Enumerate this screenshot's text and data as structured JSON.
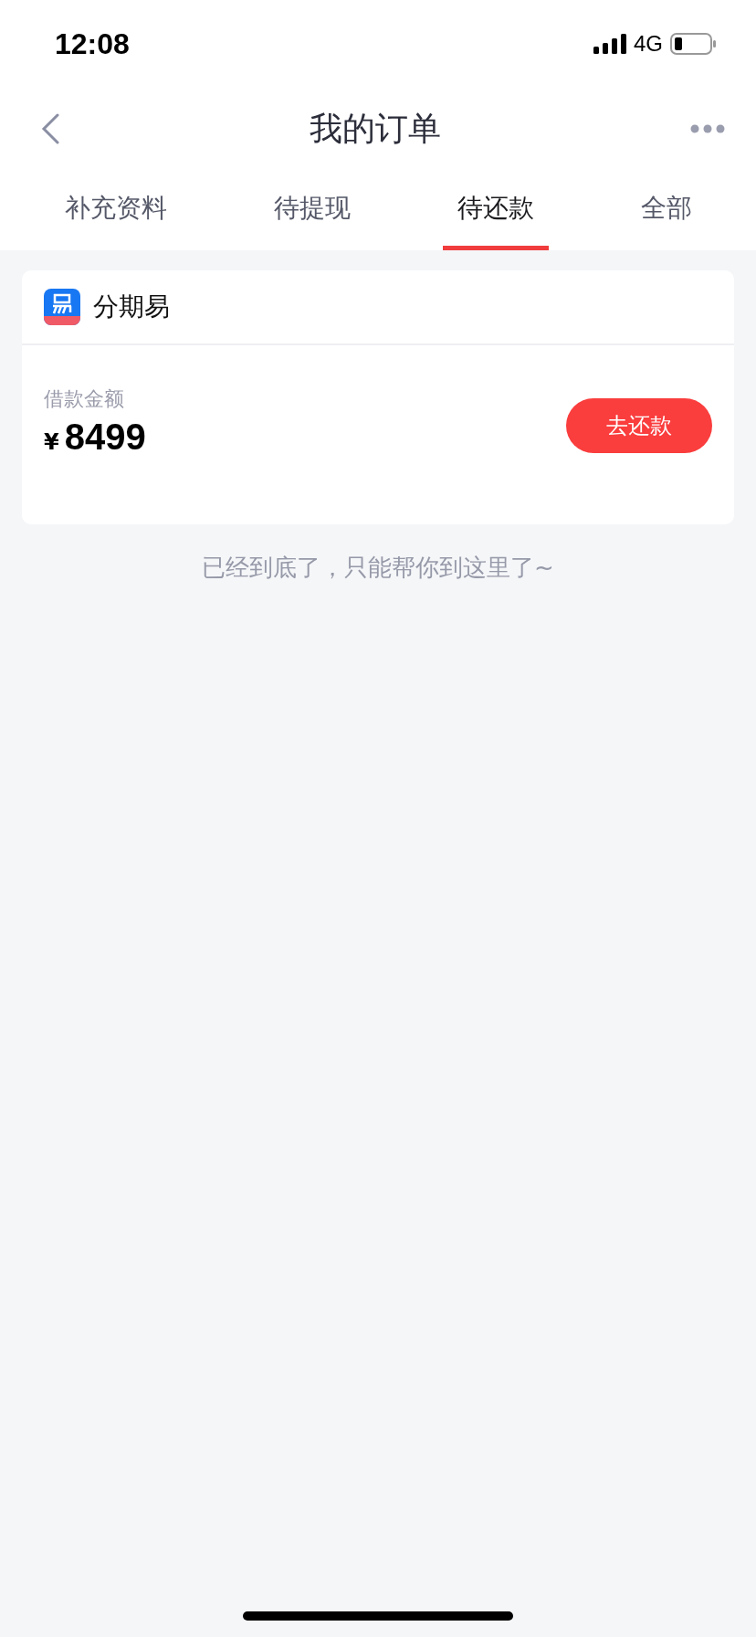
{
  "status_bar": {
    "time": "12:08",
    "network": "4G"
  },
  "nav": {
    "title": "我的订单"
  },
  "tabs": [
    {
      "label": "补充资料",
      "selected": false
    },
    {
      "label": "待提现",
      "selected": false
    },
    {
      "label": "待还款",
      "selected": true
    },
    {
      "label": "全部",
      "selected": false
    }
  ],
  "orders": [
    {
      "product": "分期易",
      "amount_label": "借款金额",
      "currency": "¥",
      "amount": "8499",
      "action": "去还款"
    }
  ],
  "footer_note": "已经到底了，只能帮你到这里了~"
}
